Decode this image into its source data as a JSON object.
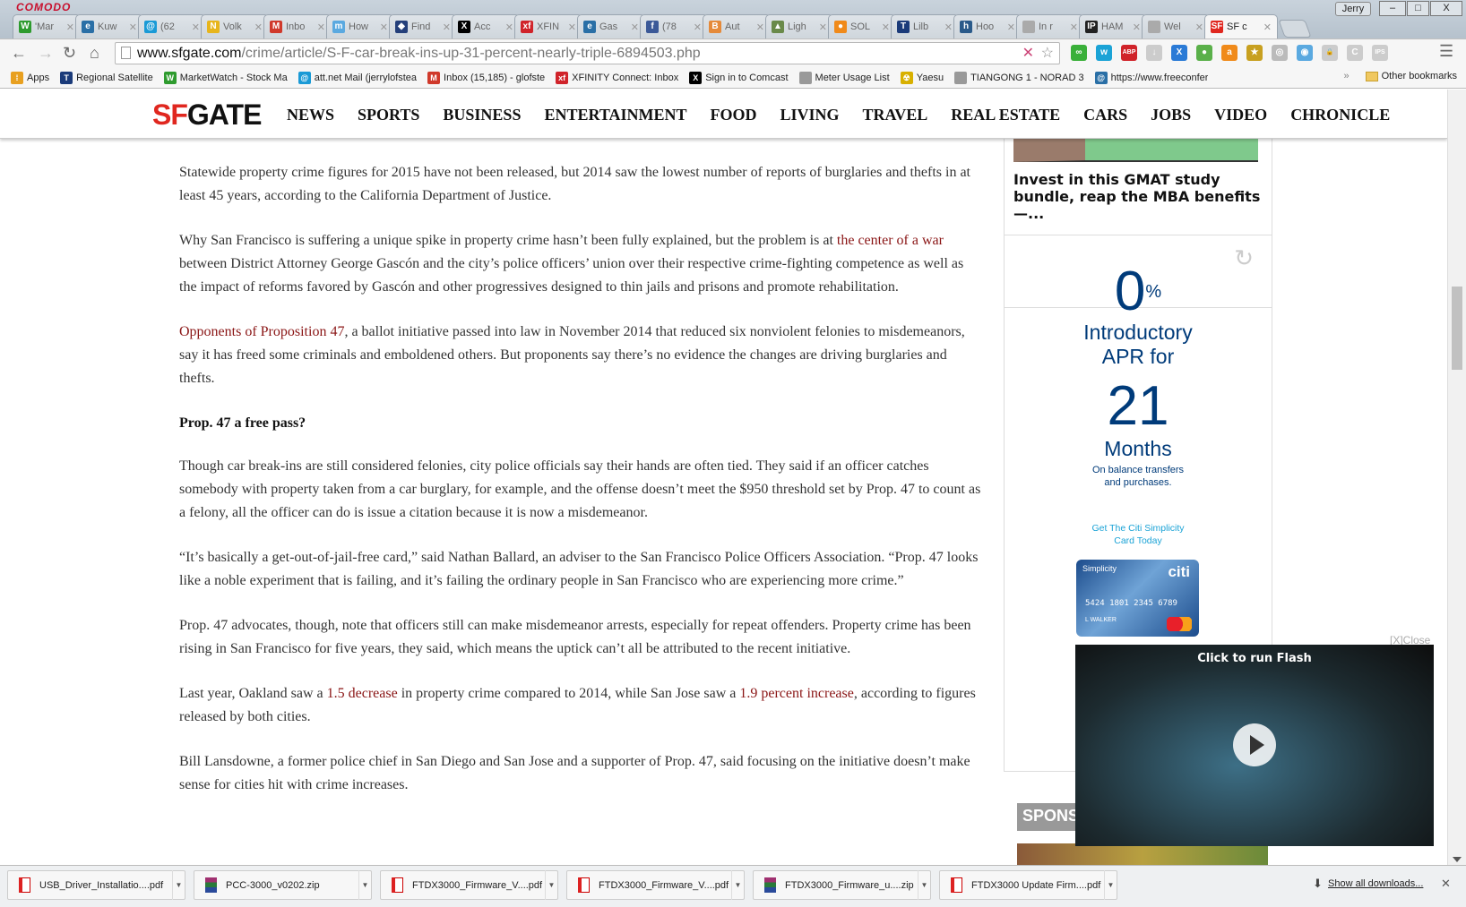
{
  "browser": {
    "brand": "COMODO",
    "profile": "Jerry",
    "tabs": [
      {
        "label": "'Mar",
        "color": "#2e9b2e",
        "glyph": "W"
      },
      {
        "label": "Kuw",
        "color": "#2a6fa6",
        "glyph": "e"
      },
      {
        "label": "(62",
        "color": "#1a9ad6",
        "glyph": "@"
      },
      {
        "label": "Volk",
        "color": "#e7b51c",
        "glyph": "N"
      },
      {
        "label": "Inbo",
        "color": "#d0392b",
        "glyph": "M"
      },
      {
        "label": "How",
        "color": "#5aa9e0",
        "glyph": "m"
      },
      {
        "label": "Find",
        "color": "#243f7a",
        "glyph": "◆"
      },
      {
        "label": "Acc",
        "color": "#000000",
        "glyph": "X"
      },
      {
        "label": "XFIN",
        "color": "#d0232a",
        "glyph": "xf"
      },
      {
        "label": "Gas",
        "color": "#2a6fa6",
        "glyph": "e"
      },
      {
        "label": "(78",
        "color": "#3b5998",
        "glyph": "f"
      },
      {
        "label": "Aut",
        "color": "#e58a3a",
        "glyph": "B"
      },
      {
        "label": "Ligh",
        "color": "#6a8a4a",
        "glyph": "▲"
      },
      {
        "label": "SOL",
        "color": "#f08a1a",
        "glyph": "●"
      },
      {
        "label": "Lilb",
        "color": "#1b3b7a",
        "glyph": "T"
      },
      {
        "label": "Hoo",
        "color": "#2a5a8a",
        "glyph": "h"
      },
      {
        "label": "In r",
        "color": "#aaaaaa",
        "glyph": ""
      },
      {
        "label": "HAM",
        "color": "#222222",
        "glyph": "IP"
      },
      {
        "label": "Wel",
        "color": "#aaaaaa",
        "glyph": ""
      },
      {
        "label": "SF c",
        "color": "#e0271f",
        "glyph": "SF",
        "active": true
      }
    ],
    "url_host": "www.sfgate.com",
    "url_path": "/crime/article/S-F-car-break-ins-up-31-percent-nearly-triple-6894503.php",
    "bookmarks": [
      {
        "label": "Apps",
        "color": "#e8a020",
        "glyph": "⁞"
      },
      {
        "label": "Regional Satellite",
        "color": "#1b3b7a",
        "glyph": "T"
      },
      {
        "label": "MarketWatch - Stock Ma",
        "color": "#2e9b2e",
        "glyph": "W"
      },
      {
        "label": "att.net Mail (jerrylofstea",
        "color": "#1a9ad6",
        "glyph": "@"
      },
      {
        "label": "Inbox (15,185) - glofste",
        "color": "#d0392b",
        "glyph": "M"
      },
      {
        "label": "XFINITY Connect: Inbox",
        "color": "#d0232a",
        "glyph": "xf"
      },
      {
        "label": "Sign in to Comcast",
        "color": "#000000",
        "glyph": "X"
      },
      {
        "label": "Meter Usage List",
        "color": "#999999",
        "glyph": ""
      },
      {
        "label": "Yaesu",
        "color": "#d8b000",
        "glyph": "☢"
      },
      {
        "label": "TIANGONG 1 - NORAD 3",
        "color": "#999999",
        "glyph": ""
      },
      {
        "label": "https://www.freeconfer",
        "color": "#2a6fa6",
        "glyph": "@"
      }
    ],
    "other_bookmarks": "Other bookmarks",
    "extensions": [
      {
        "name": "chromodo-green",
        "color": "#3ab03a",
        "glyph": "∞"
      },
      {
        "name": "w-ext",
        "color": "#1ba3d6",
        "glyph": "w"
      },
      {
        "name": "adblock",
        "color": "#d0232a",
        "glyph": "ABP"
      },
      {
        "name": "download",
        "color": "#cccccc",
        "glyph": "↓"
      },
      {
        "name": "x-translate",
        "color": "#2a7ad6",
        "glyph": "X"
      },
      {
        "name": "frog",
        "color": "#5ab04a",
        "glyph": "●"
      },
      {
        "name": "amazon",
        "color": "#f08a1a",
        "glyph": "a"
      },
      {
        "name": "sheriff",
        "color": "#c8a020",
        "glyph": "★"
      },
      {
        "name": "camera",
        "color": "#bbbbbb",
        "glyph": "◎"
      },
      {
        "name": "shield",
        "color": "#5aa9e0",
        "glyph": "◉"
      },
      {
        "name": "lock",
        "color": "#cccccc",
        "glyph": "🔒"
      },
      {
        "name": "c-ext",
        "color": "#cccccc",
        "glyph": "C"
      },
      {
        "name": "ips",
        "color": "#cccccc",
        "glyph": "IPS"
      }
    ]
  },
  "site": {
    "logo_sf": "SF",
    "logo_gate": "GATE",
    "nav": [
      "NEWS",
      "SPORTS",
      "BUSINESS",
      "ENTERTAINMENT",
      "FOOD",
      "LIVING",
      "TRAVEL",
      "REAL ESTATE",
      "CARS",
      "JOBS",
      "VIDEO",
      "CHRONICLE"
    ]
  },
  "article": [
    {
      "type": "p",
      "segments": [
        {
          "text": "Statewide property crime figures for 2015 have not been released, but 2014 saw the lowest number of reports of burglaries and thefts in at least 45 years, according to the California Department of Justice."
        }
      ]
    },
    {
      "type": "p",
      "segments": [
        {
          "text": "Why San Francisco is suffering a unique spike in property crime hasn’t been fully explained, but the problem is at "
        },
        {
          "text": "the center of a war",
          "link": true
        },
        {
          "text": " between District Attorney George Gascón and the city’s police officers’ union over their respective crime-fighting competence as well as the impact of reforms favored by Gascón and other progressives designed to thin jails and prisons and promote rehabilitation."
        }
      ]
    },
    {
      "type": "p",
      "segments": [
        {
          "text": "Opponents of Proposition 47",
          "link": true
        },
        {
          "text": ", a ballot initiative passed into law in November 2014 that reduced six nonviolent felonies to misdemeanors, say it has freed some criminals and emboldened others. But proponents say there’s no evidence the changes are driving burglaries and thefts."
        }
      ]
    },
    {
      "type": "h",
      "segments": [
        {
          "text": "Prop. 47 a free pass?"
        }
      ]
    },
    {
      "type": "p",
      "segments": [
        {
          "text": "Though car break-ins are still considered felonies, city police officials say their hands are often tied. They said if an officer catches somebody with property taken from a car burglary, for example, and the offense doesn’t meet the $950 threshold set by Prop. 47 to count as a felony, all the officer can do is issue a citation because it is now a misdemeanor."
        }
      ]
    },
    {
      "type": "p",
      "segments": [
        {
          "text": "“It’s basically a get-out-of-jail-free card,” said Nathan Ballard, an adviser to the San Francisco Police Officers Association. “Prop. 47 looks like a noble experiment that is failing, and it’s failing the ordinary people in San Francisco who are experiencing more crime.”"
        }
      ]
    },
    {
      "type": "p",
      "segments": [
        {
          "text": "Prop. 47 advocates, though, note that officers still can make misdemeanor arrests, especially for repeat offenders. Property crime has been rising in San Francisco for five years, they said, which means the uptick can’t all be attributed to the recent initiative."
        }
      ]
    },
    {
      "type": "p",
      "segments": [
        {
          "text": "Last year, Oakland saw a "
        },
        {
          "text": "1.5 decrease",
          "link": true
        },
        {
          "text": " in property crime compared to 2014, while San Jose saw a "
        },
        {
          "text": "1.9 percent increase",
          "link": true
        },
        {
          "text": ", according to figures released by both cities."
        }
      ]
    },
    {
      "type": "p",
      "segments": [
        {
          "text": "Bill Lansdowne, a former police chief in San Diego and San Jose and a supporter of Prop. 47, said focusing on the initiative doesn’t make sense for cities hit with crime increases."
        }
      ]
    }
  ],
  "rail": {
    "promo_caption": "Invest in this GMAT study bundle, reap the MBA benefits —...",
    "ad": {
      "rate": "0",
      "pct": "%",
      "intro": "Introductory APR for",
      "months_num": "21",
      "months": "Months",
      "fine": "On balance transfers and purchases.",
      "cta": "Get The Citi Simplicity Card Today",
      "card_brand": "Simplicity",
      "card_logo": "citi",
      "card_number": "5424 1801 2345 6789",
      "card_name": "L WALKER"
    },
    "sponsored": "SPONSO"
  },
  "flash": {
    "close": "[X]Close",
    "label": "Click to run Flash"
  },
  "downloads": {
    "items": [
      {
        "name": "USB_Driver_Installatio....pdf",
        "type": "pdf"
      },
      {
        "name": "PCC-3000_v0202.zip",
        "type": "zip"
      },
      {
        "name": "FTDX3000_Firmware_V....pdf",
        "type": "pdf"
      },
      {
        "name": "FTDX3000_Firmware_V....pdf",
        "type": "pdf"
      },
      {
        "name": "FTDX3000_Firmware_u....zip",
        "type": "zip"
      },
      {
        "name": "FTDX3000 Update Firm....pdf",
        "type": "pdf"
      }
    ],
    "show_all": "Show all downloads..."
  }
}
